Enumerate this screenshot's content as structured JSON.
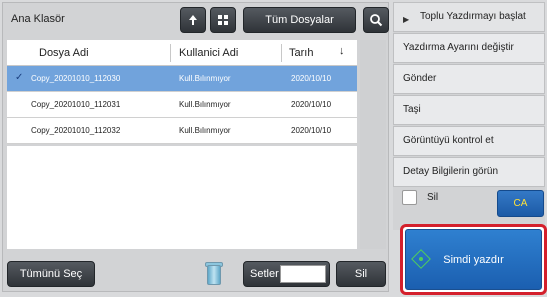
{
  "header": {
    "folder_label": "Ana Klasör",
    "all_files_label": "Tüm Dosyalar"
  },
  "table": {
    "columns": [
      "Dosya Adi",
      "Kullanici Adi",
      "Tarıh"
    ],
    "rows": [
      {
        "name": "Copy_20201010_112030",
        "user": "Kull.Bılınmıyor",
        "date": "2020/10/10",
        "selected": true
      },
      {
        "name": "Copy_20201010_112031",
        "user": "Kull.Bılınmıyor",
        "date": "2020/10/10",
        "selected": false
      },
      {
        "name": "Copy_20201010_112032",
        "user": "Kull.Bılınmıyor",
        "date": "2020/10/10",
        "selected": false
      }
    ]
  },
  "bottom": {
    "select_all_label": "Tümünü Seç",
    "sets_label": "Setler",
    "sets_value": "",
    "delete_label": "Sil"
  },
  "right_panel": {
    "items": [
      "Toplu Yazdırmayı başlat",
      "Yazdırma Ayarını değiştir",
      "Gönder",
      "Taşi",
      "Görüntüyü kontrol et",
      "Detay Bilgilerin görün"
    ],
    "sil_label": "Sil",
    "ca_label": "CA",
    "print_now_label": "Simdi yazdır"
  },
  "colors": {
    "selected_row": "#71a3dc",
    "accent_blue": "#1b5fb0",
    "highlight_red": "#d4202c",
    "ca_text": "#ffe13a"
  }
}
